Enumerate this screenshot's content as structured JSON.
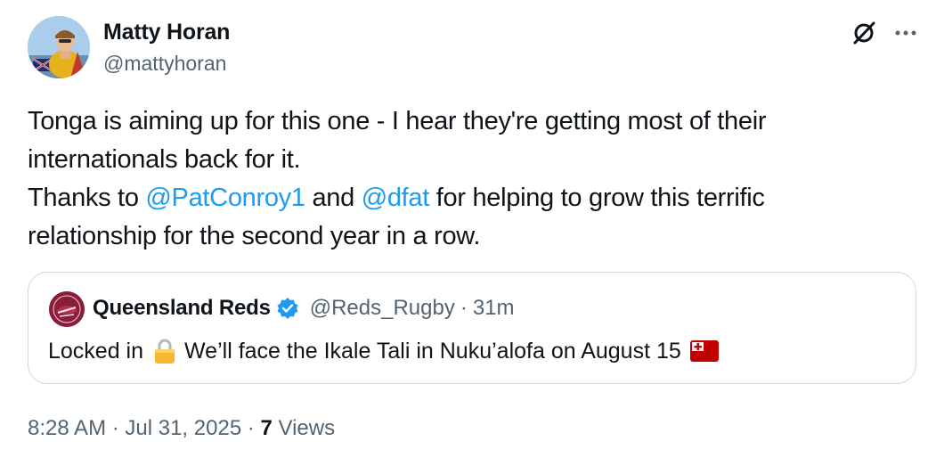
{
  "author": {
    "name": "Matty Horan",
    "handle": "@mattyhoran"
  },
  "tweet": {
    "line1": "Tonga is aiming up for this one - I hear they're getting most of their",
    "line2": "internationals back for it.",
    "line3_prefix": "Thanks to ",
    "mention1": "@PatConroy1",
    "line3_mid": " and ",
    "mention2": "@dfat",
    "line3_suffix": " for helping to grow this terrific",
    "line4": "relationship for the second year in a row."
  },
  "quote": {
    "name": "Queensland Reds",
    "handle": "@Reds_Rugby",
    "separator": "·",
    "time": "31m",
    "text_before": "Locked in",
    "text_after": "We’ll face the Ikale Tali in Nuku’alofa on August 15",
    "lock_icon": "lock-icon",
    "flag_icon": "tonga-flag-icon"
  },
  "meta": {
    "time": "8:28 AM",
    "sep1": " · ",
    "date": "Jul 31, 2025",
    "sep2": " · ",
    "views_count": "7",
    "views_label": " Views"
  },
  "colors": {
    "mention": "#1d9bf0",
    "secondary": "#536471",
    "border": "#cfd9de",
    "verified": "#1d9bf0"
  }
}
